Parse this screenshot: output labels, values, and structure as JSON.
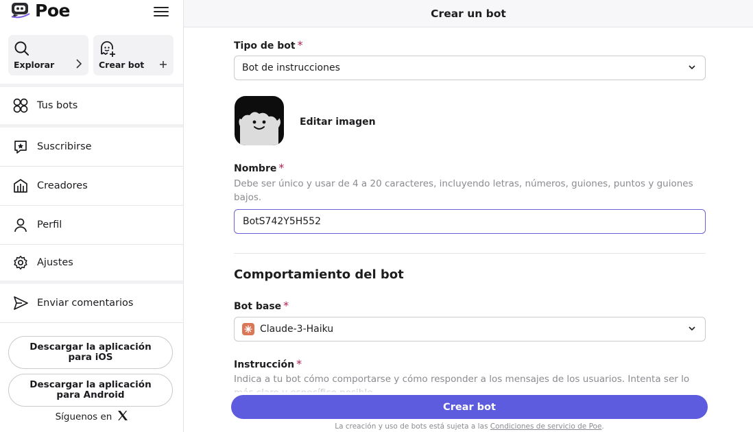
{
  "app": {
    "name": "Poe"
  },
  "sidebar": {
    "tiles": [
      {
        "label": "Explorar",
        "icon": "search-icon",
        "action_icon": "chevron-right-icon"
      },
      {
        "label": "Crear bot",
        "icon": "bot-add-icon",
        "action_icon": "plus-icon"
      }
    ],
    "items": [
      {
        "label": "Tus bots",
        "icon": "bots-icon"
      },
      {
        "label": "Suscribirse",
        "icon": "subscribe-icon"
      },
      {
        "label": "Creadores",
        "icon": "creators-icon"
      },
      {
        "label": "Perfil",
        "icon": "profile-icon"
      },
      {
        "label": "Ajustes",
        "icon": "gear-icon"
      },
      {
        "label": "Enviar comentarios",
        "icon": "send-icon"
      }
    ],
    "download_ios": "Descargar la aplicación para iOS",
    "download_android": "Descargar la aplicación para Android",
    "follow_label": "Síguenos en"
  },
  "header": {
    "title": "Crear un bot"
  },
  "form": {
    "bot_type": {
      "label": "Tipo de bot",
      "required": "*",
      "value": "Bot de instrucciones"
    },
    "image": {
      "edit_label": "Editar imagen"
    },
    "name": {
      "label": "Nombre",
      "required": "*",
      "help": "Debe ser único y usar de 4 a 20 caracteres, incluyendo letras, números, guiones, puntos y guiones bajos.",
      "value": "BotS742Y5H552"
    },
    "behavior_title": "Comportamiento del bot",
    "base_bot": {
      "label": "Bot base",
      "required": "*",
      "value": "Claude-3-Haiku"
    },
    "instruction": {
      "label": "Instrucción",
      "required": "*",
      "help": "Indica a tu bot cómo comportarse y cómo responder a los mensajes de los usuarios. Intenta ser lo más claro y específico posible."
    },
    "submit_label": "Crear bot",
    "footnote_prefix": "La creación y uso de bots está sujeta a las ",
    "footnote_link": "Condiciones de servicio de Poe",
    "footnote_suffix": "."
  },
  "colors": {
    "accent": "#5d5cde",
    "required": "#b3204d",
    "input_focus": "#6b5fd9",
    "claude_icon": "#d97757"
  }
}
